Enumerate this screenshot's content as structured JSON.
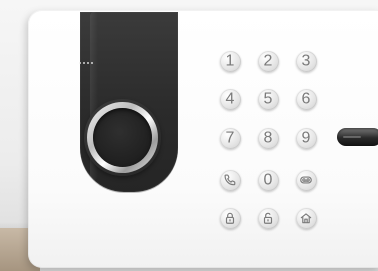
{
  "keypad": {
    "rows": [
      [
        {
          "type": "digit",
          "label": "1",
          "name": "key-1"
        },
        {
          "type": "digit",
          "label": "2",
          "name": "key-2"
        },
        {
          "type": "digit",
          "label": "3",
          "name": "key-3"
        }
      ],
      [
        {
          "type": "digit",
          "label": "4",
          "name": "key-4"
        },
        {
          "type": "digit",
          "label": "5",
          "name": "key-5"
        },
        {
          "type": "digit",
          "label": "6",
          "name": "key-6"
        }
      ],
      [
        {
          "type": "digit",
          "label": "7",
          "name": "key-7"
        },
        {
          "type": "digit",
          "label": "8",
          "name": "key-8"
        },
        {
          "type": "digit",
          "label": "9",
          "name": "key-9"
        }
      ],
      [
        {
          "type": "icon",
          "icon": "phone-icon",
          "name": "call-button"
        },
        {
          "type": "digit",
          "label": "0",
          "name": "key-0"
        },
        {
          "type": "icon",
          "icon": "voicemail-icon",
          "name": "voicemail-button"
        }
      ],
      [
        {
          "type": "icon",
          "icon": "lock-icon",
          "name": "arm-away-button"
        },
        {
          "type": "icon",
          "icon": "unlock-icon",
          "name": "disarm-button"
        },
        {
          "type": "icon",
          "icon": "home-icon",
          "name": "arm-home-button"
        }
      ]
    ]
  },
  "colors": {
    "device_white": "#ffffff",
    "panel_dark": "#2b2b2b",
    "key_symbol_gray": "#7a7a7a",
    "background_gray": "#ececec",
    "table_wood": "#a69580"
  },
  "icons": {
    "status_leds": "led-dots-icon",
    "fingerprint_reader": "ring-icon",
    "slot": "card-slot-icon"
  }
}
